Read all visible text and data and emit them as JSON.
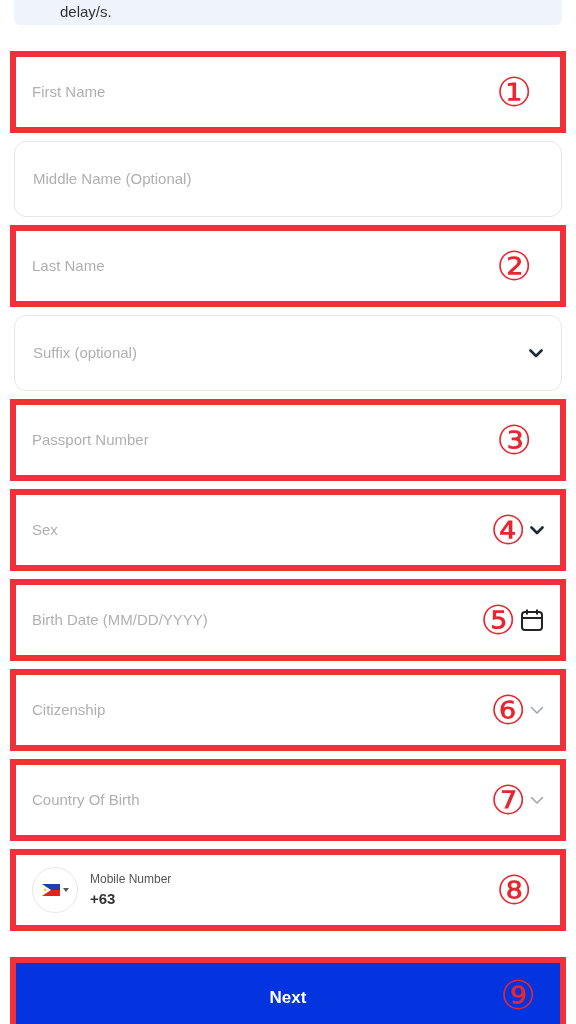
{
  "notice": {
    "text": "delay/s."
  },
  "fields": [
    {
      "kind": "text",
      "placeholder": "First Name",
      "highlighted": true,
      "marker": "①"
    },
    {
      "kind": "text",
      "placeholder": "Middle Name (Optional)",
      "highlighted": false
    },
    {
      "kind": "text",
      "placeholder": "Last Name",
      "highlighted": true,
      "marker": "②"
    },
    {
      "kind": "select",
      "placeholder": "Suffix (optional)",
      "highlighted": false
    },
    {
      "kind": "text",
      "placeholder": "Passport Number",
      "highlighted": true,
      "marker": "③"
    },
    {
      "kind": "select",
      "placeholder": "Sex",
      "highlighted": true,
      "marker": "④"
    },
    {
      "kind": "date",
      "placeholder": "Birth Date (MM/DD/YYYY)",
      "highlighted": true,
      "marker": "⑤"
    },
    {
      "kind": "combobox",
      "placeholder": "Citizenship",
      "highlighted": true,
      "marker": "⑥"
    },
    {
      "kind": "combobox",
      "placeholder": "Country Of Birth",
      "highlighted": true,
      "marker": "⑦"
    },
    {
      "kind": "phone",
      "label": "Mobile Number",
      "value": "+63",
      "highlighted": true,
      "marker": "⑧"
    }
  ],
  "next_button": {
    "label": "Next",
    "highlighted": true,
    "marker": "⑨"
  }
}
